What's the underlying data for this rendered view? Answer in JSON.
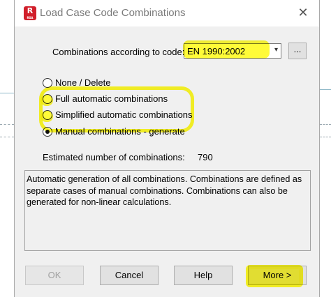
{
  "window": {
    "title": "Load Case Code Combinations",
    "app_icon_text": "R",
    "app_icon_subtext": "RSA",
    "close_glyph": "✕"
  },
  "code": {
    "label": "Combinations according to code:",
    "selected": "EN 1990:2002",
    "dropdown_glyph": "▾",
    "browse_label": "..."
  },
  "options": [
    {
      "label": "None / Delete",
      "checked": false
    },
    {
      "label": "Full automatic combinations",
      "checked": false
    },
    {
      "label": "Simplified automatic combinations",
      "checked": false
    },
    {
      "label": "Manual combinations - generate",
      "checked": true
    }
  ],
  "estimate": {
    "label": "Estimated number of combinations:",
    "value": "790"
  },
  "description": "Automatic generation of all combinations. Combinations are defined as separate cases of manual combinations. Combinations can also be generated for non-linear calculations.",
  "buttons": {
    "ok": "OK",
    "cancel": "Cancel",
    "help": "Help",
    "more": "More >"
  },
  "colors": {
    "highlight": "#fffa00",
    "app_icon": "#d11f2b"
  }
}
